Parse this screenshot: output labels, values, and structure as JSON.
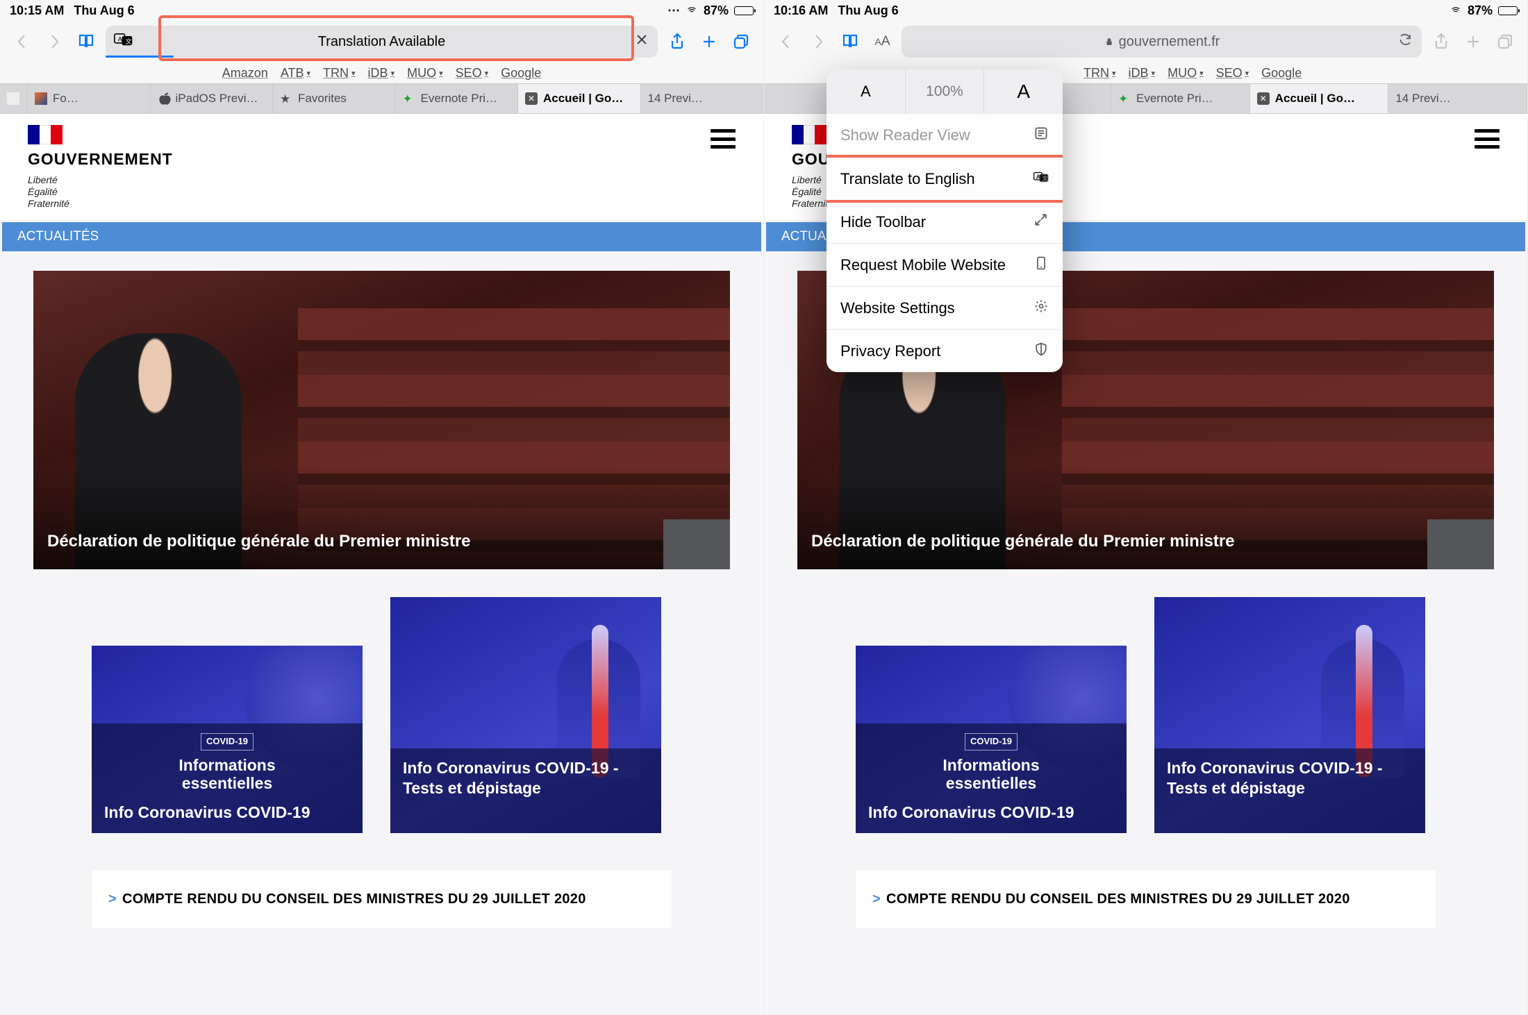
{
  "left": {
    "status": {
      "time": "10:15 AM",
      "date": "Thu Aug 6",
      "battery_pct": "87%"
    },
    "address_pill_label": "Translation Available",
    "favorites": [
      "Amazon",
      "ATB",
      "TRN",
      "iDB",
      "MUO",
      "SEO",
      "Google"
    ],
    "tabs": [
      {
        "label": "Fo…",
        "icon": "fox"
      },
      {
        "label": "iPadOS Previ…",
        "icon": "apple"
      },
      {
        "label": "Favorites",
        "icon": "star"
      },
      {
        "label": "Evernote Pri…",
        "icon": "evernote"
      },
      {
        "label": "Accueil | Go…",
        "icon": "x",
        "active": true
      },
      {
        "label": "14 Previ…",
        "icon": ""
      }
    ]
  },
  "right": {
    "status": {
      "time": "10:16 AM",
      "date": "Thu Aug 6",
      "battery_pct": "87%"
    },
    "address_domain": "gouvernement.fr",
    "favorites": [
      "TRN",
      "iDB",
      "MUO",
      "SEO",
      "Google"
    ],
    "tabs": [
      {
        "label": "Evernote Pri…",
        "icon": "evernote"
      },
      {
        "label": "Accueil | Go…",
        "icon": "x",
        "active": true
      },
      {
        "label": "14 Previ…",
        "icon": ""
      }
    ],
    "popover": {
      "zoom": "100%",
      "reader": "Show Reader View",
      "translate": "Translate to English",
      "hide_toolbar": "Hide Toolbar",
      "request_mobile": "Request Mobile Website",
      "website_settings": "Website Settings",
      "privacy_report": "Privacy Report"
    }
  },
  "page": {
    "brand": "GOUVERNEMENT",
    "motto1": "Liberté",
    "motto2": "Égalité",
    "motto3": "Fraternité",
    "section": "ACTUALITÉS",
    "hero_caption": "Déclaration de politique générale du Premier ministre",
    "card1_pill": "COVID-19",
    "card1_mid_line1": "Informations",
    "card1_mid_line2": "essentielles",
    "card1_strip": "Info Coronavirus COVID-19",
    "card2_strip_l1": "Info Coronavirus COVID-19 -",
    "card2_strip_l2": "Tests et dépistage",
    "compte": "COMPTE RENDU DU CONSEIL DES MINISTRES DU 29 JUILLET 2020"
  }
}
